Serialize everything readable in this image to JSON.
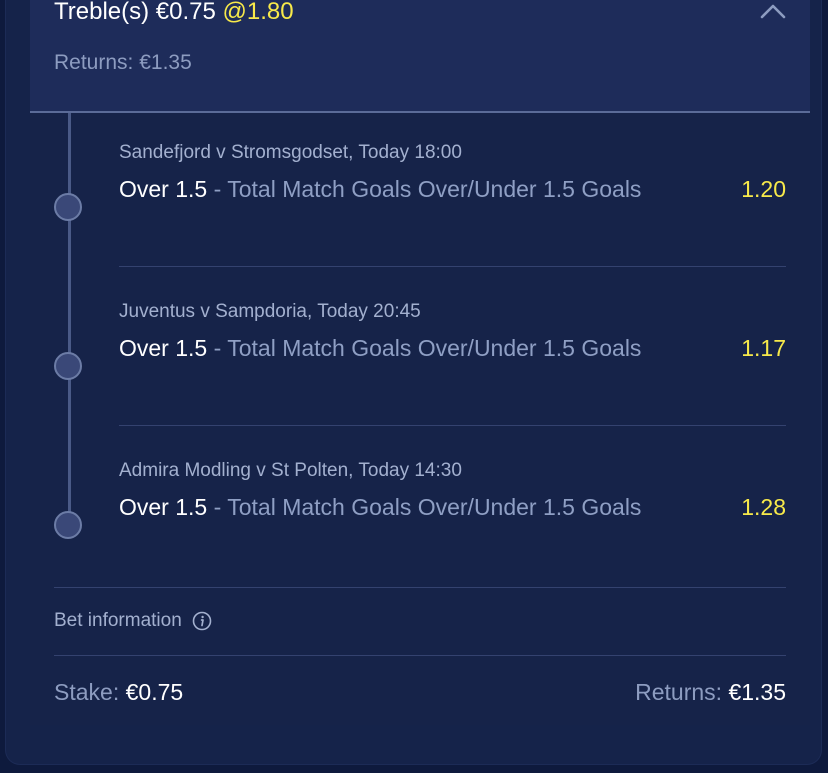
{
  "header": {
    "bet_type": "Treble(s)",
    "stake": "€0.75",
    "odds": "@1.80",
    "returns_label": "Returns:",
    "returns_value": "€1.35"
  },
  "selections": [
    {
      "event": "Sandefjord v Stromsgodset, Today 18:00",
      "pick": "Over 1.5",
      "market": " - Total Match Goals Over/Under 1.5 Goals",
      "price": "1.20"
    },
    {
      "event": "Juventus v Sampdoria, Today 20:45",
      "pick": "Over 1.5",
      "market": " - Total Match Goals Over/Under 1.5 Goals",
      "price": "1.17"
    },
    {
      "event": "Admira Modling v St Polten, Today 14:30",
      "pick": "Over 1.5",
      "market": " - Total Match Goals Over/Under 1.5 Goals",
      "price": "1.28"
    }
  ],
  "footer": {
    "bet_info_label": "Bet information",
    "info_icon": "info-icon",
    "stake_label": "Stake:",
    "stake_value": "€0.75",
    "returns_label": "Returns:",
    "returns_value": "€1.35"
  },
  "colors": {
    "background": "#162349",
    "header_bg": "#1e2c5a",
    "odds_accent": "#f7e94a"
  }
}
